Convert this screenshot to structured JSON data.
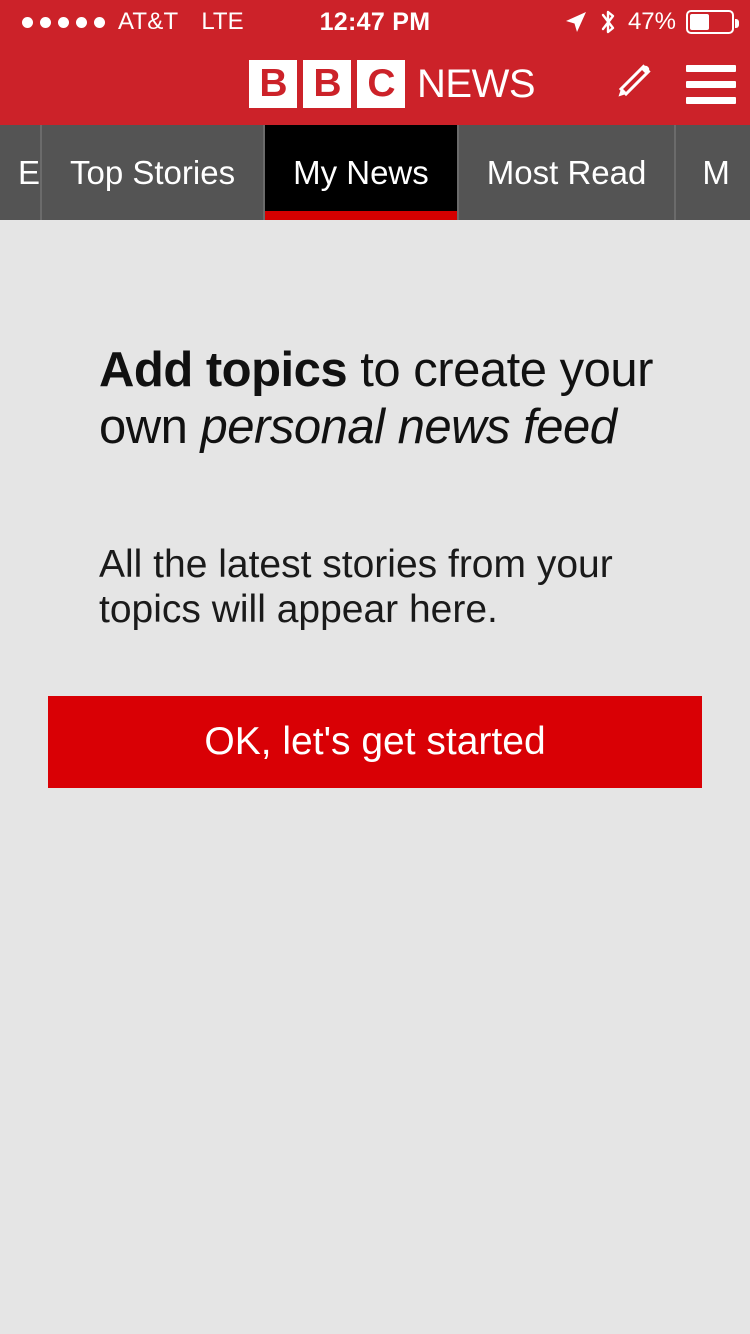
{
  "status_bar": {
    "signal_dots": 5,
    "carrier": "AT&T",
    "network": "LTE",
    "time": "12:47 PM",
    "battery_percent": "47%",
    "battery_level": 47,
    "location_icon": "location-arrow-icon",
    "bluetooth_icon": "bluetooth-icon",
    "background_color": "#cc2229"
  },
  "header": {
    "logo": {
      "block_1": "B",
      "block_2": "B",
      "block_3": "C",
      "word": "NEWS"
    },
    "edit_icon": "pencil-icon",
    "menu_icon": "hamburger-menu-icon",
    "background_color": "#cc2229"
  },
  "tabs": {
    "items": [
      {
        "label": "E",
        "active": false,
        "partial": "left"
      },
      {
        "label": "Top Stories",
        "active": false,
        "partial": "none"
      },
      {
        "label": "My News",
        "active": true,
        "partial": "none"
      },
      {
        "label": "Most Read",
        "active": false,
        "partial": "none"
      },
      {
        "label": "M",
        "active": false,
        "partial": "right"
      }
    ],
    "active_tab": "My News",
    "active_background": "#000000",
    "active_underline_color": "#d40000",
    "inactive_background": "#545454"
  },
  "main": {
    "headline": {
      "bold_part": "Add topics",
      "regular_part": " to create your own ",
      "italic_part": "personal news feed"
    },
    "subtext": "All the latest stories from your topics will appear here.",
    "cta_label": "OK, let's get started",
    "cta_color": "#d90005",
    "background_color": "#e5e5e5"
  }
}
